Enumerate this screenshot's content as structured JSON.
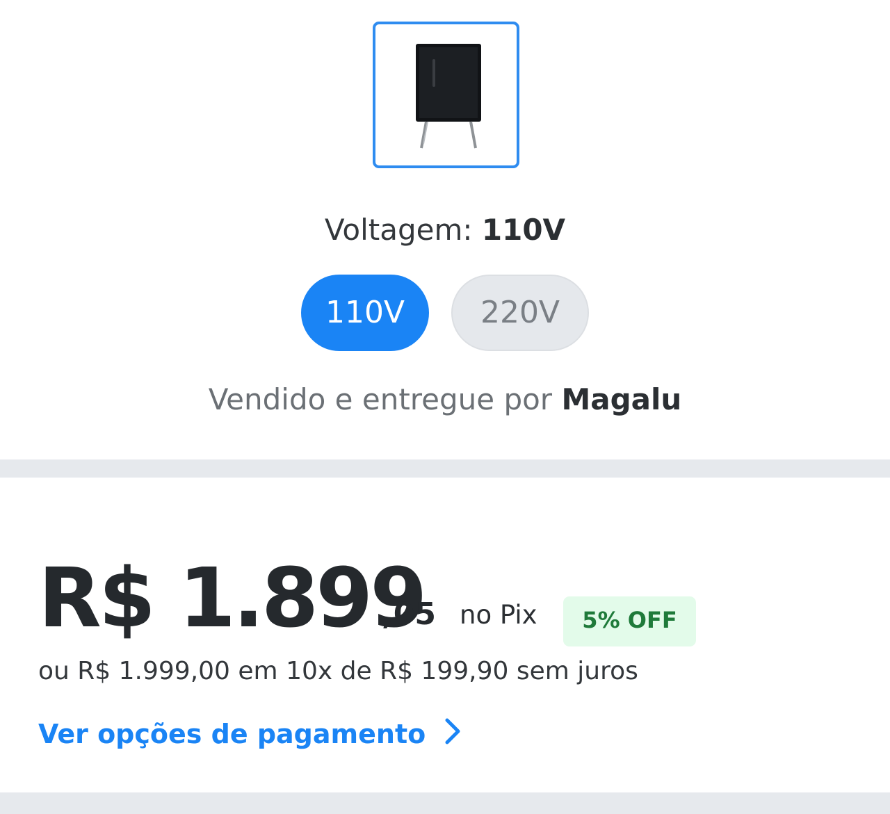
{
  "product": {
    "thumbnail_icon": "refrigerator-thumbnail"
  },
  "voltage": {
    "label": "Voltagem:",
    "selected": "110V",
    "options": [
      {
        "label": "110V",
        "selected": true
      },
      {
        "label": "220V",
        "selected": false
      }
    ]
  },
  "seller": {
    "prefix": "Vendido e entregue por",
    "name": "Magalu"
  },
  "price": {
    "main": "R$ 1.899",
    "cents": ",05",
    "method": "no Pix",
    "discount_badge": "5% OFF",
    "installments": "ou R$ 1.999,00 em 10x de R$ 199,90 sem juros"
  },
  "payment_link": {
    "label": "Ver opções de pagamento",
    "icon": "chevron-right-icon"
  },
  "colors": {
    "accent": "#1a84f5",
    "discount_bg": "#e3fbea",
    "discount_text": "#1f7a3a"
  }
}
